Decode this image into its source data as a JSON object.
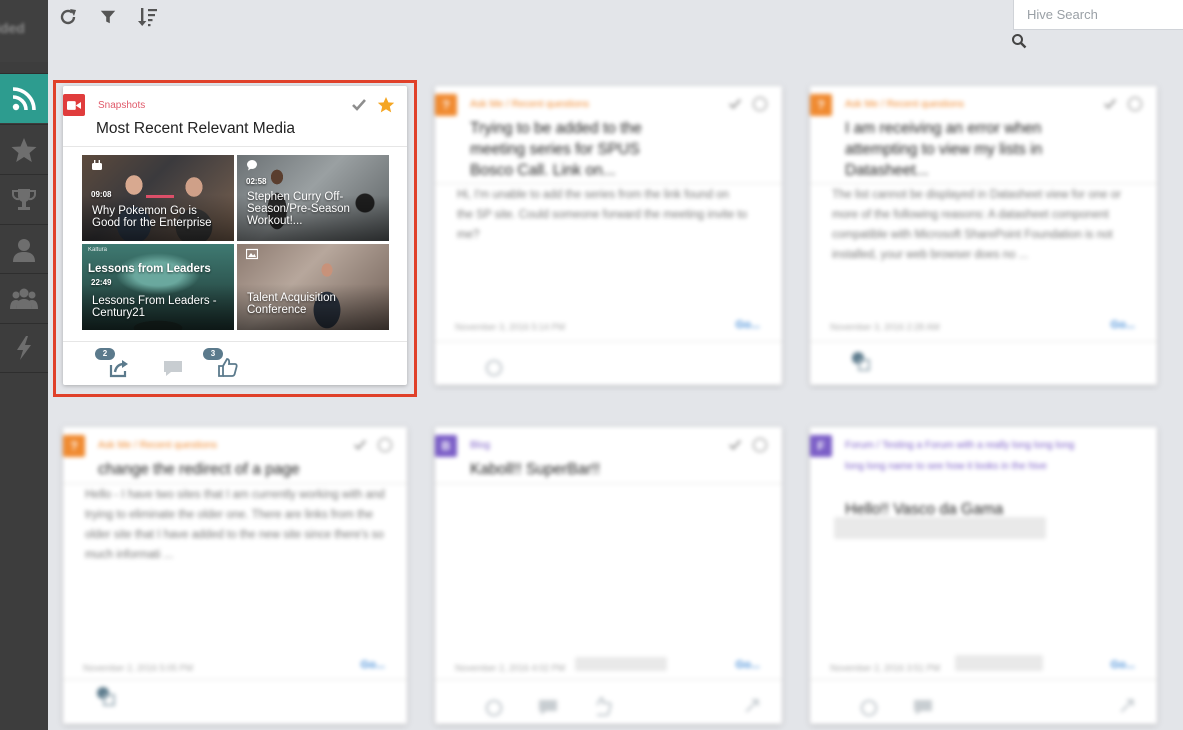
{
  "sidebar": {
    "top_label": "ided",
    "items": [
      {
        "name": "feed",
        "icon": "rss-icon",
        "active": true
      },
      {
        "name": "favorites",
        "icon": "star-icon",
        "active": false
      },
      {
        "name": "achievements",
        "icon": "trophy-icon",
        "active": false
      },
      {
        "name": "profile",
        "icon": "person-icon",
        "active": false
      },
      {
        "name": "groups",
        "icon": "people-icon",
        "active": false
      },
      {
        "name": "activity",
        "icon": "lightning-icon",
        "active": false
      }
    ]
  },
  "toolbar": {
    "refresh_icon": "refresh-icon",
    "filter_icon": "filter-icon",
    "sort_icon": "sort-icon"
  },
  "search": {
    "placeholder": "Hive Search",
    "icon": "search-icon"
  },
  "colors": {
    "sidebar_bg": "#3d3d3d",
    "sidebar_active": "#2d9c8f",
    "highlight_border": "#e0412a",
    "media_badge": "#e03c3c",
    "question_badge": "#f08a30",
    "blog_badge": "#7b5ec7",
    "star": "#f5a623"
  },
  "featured_card": {
    "source": "Snapshots",
    "title": "Most Recent Relevant Media",
    "tiles": [
      {
        "caption": "Why Pokemon Go is Good for the Enterprise",
        "duration": "09:08",
        "type_icon": "youtube-icon"
      },
      {
        "caption": "Stephen Curry Off-Season/Pre-Season Workout!...",
        "duration": "02:58",
        "type_icon": "chat-bubble-icon"
      },
      {
        "caption": "Lessons From Leaders - Century21",
        "duration": "22:49",
        "overlay_title": "Lessons from Leaders",
        "brand": "Kaltura",
        "type_icon": "video-icon"
      },
      {
        "caption": "Talent Acquisition Conference",
        "duration": "",
        "type_icon": "image-icon"
      }
    ],
    "share_count": "2",
    "like_count": "3"
  },
  "cards": [
    {
      "source": "Ask Me / Recent questions",
      "title": "Trying to be added to the meeting series for SPUS Bosco Call. Link on...",
      "excerpt": "Hi, I'm unable to add the series from the link found on the SP site. Could someone forward the meeting invite to me?",
      "date": "November 3, 2016 5:14 PM",
      "more": "Go..."
    },
    {
      "source": "Ask Me / Recent questions",
      "title": "I am receiving an error when attempting to view my lists in Datasheet...",
      "excerpt": "The list cannot be displayed in Datasheet view for one or more of the following reasons: A datasheet component compatible with Microsoft SharePoint Foundation is not installed, your web browser does no ...",
      "date": "November 3, 2016 2:28 AM",
      "more": "Go..."
    },
    {
      "source": "Ask Me / Recent questions",
      "title": "change the redirect of a page",
      "excerpt": "Hello - I have two sites that I am currently working with and trying to eliminate the older one. There are links from the older site that I have added to the new site since there's so much informati ...",
      "date": "November 2, 2016 5:05 PM",
      "more": "Go..."
    },
    {
      "source": "Blog",
      "title": "Kaboll!! SuperBar!!",
      "excerpt": "",
      "date": "November 2, 2016 4:02 PM",
      "more": "Go..."
    },
    {
      "source": "Forum / Testing a Forum with a really long long long long long name to see how it looks in the hive",
      "title": "Hello!! Vasco da Gama",
      "excerpt": "",
      "date": "November 2, 2016 3:51 PM",
      "more": "Go..."
    }
  ]
}
